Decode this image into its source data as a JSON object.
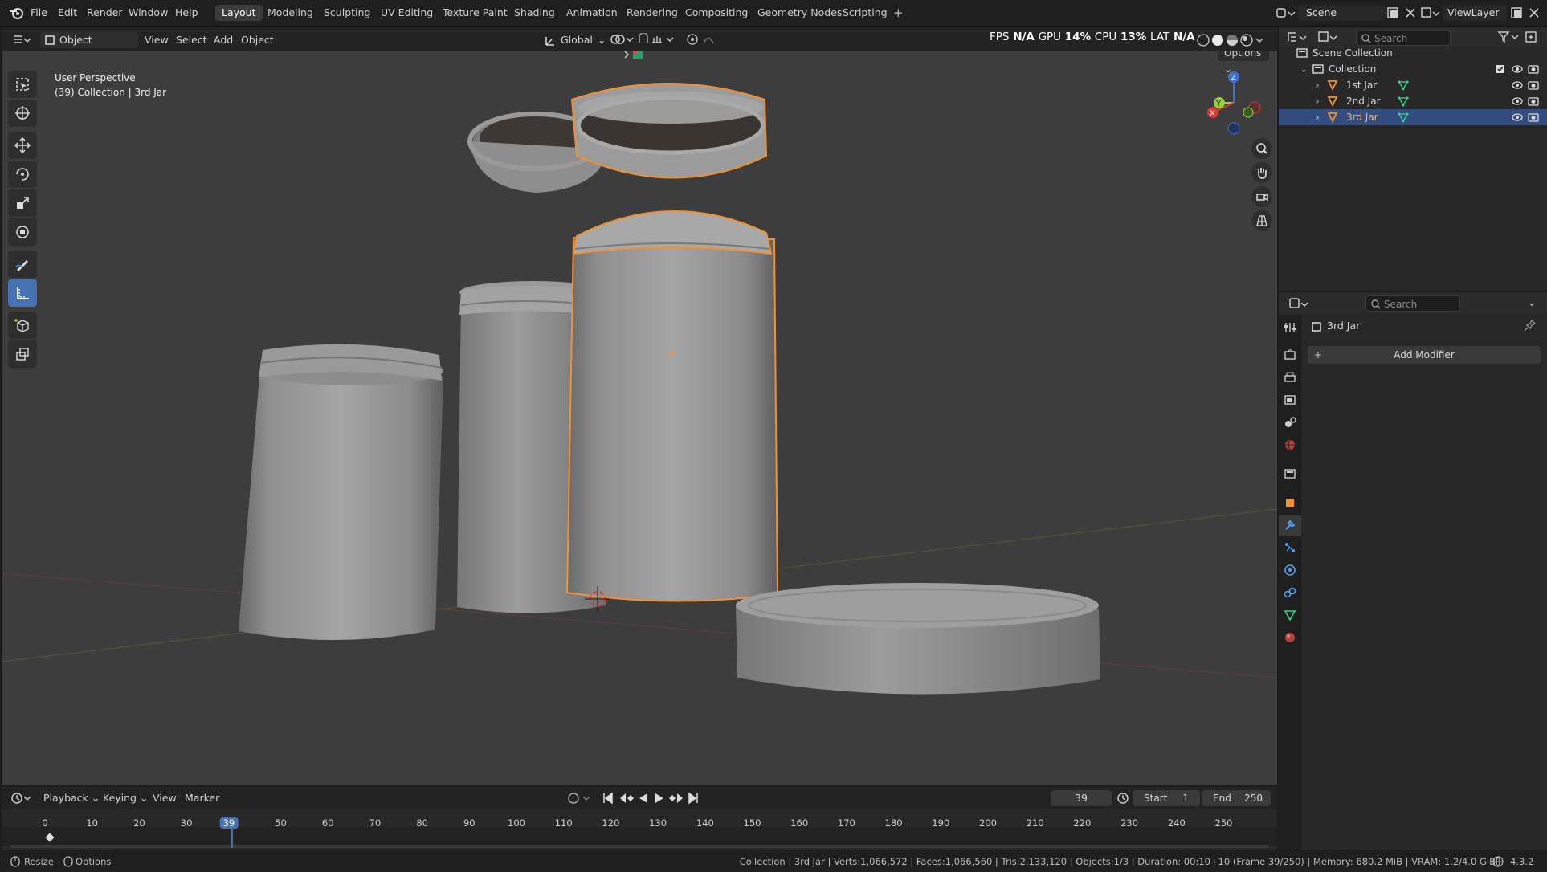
{
  "menu": {
    "file": "File",
    "edit": "Edit",
    "render": "Render",
    "window": "Window",
    "help": "Help"
  },
  "workspaces": [
    "Layout",
    "Modeling",
    "Sculpting",
    "UV Editing",
    "Texture Paint",
    "Shading",
    "Animation",
    "Rendering",
    "Compositing",
    "Geometry Nodes",
    "Scripting"
  ],
  "topright": {
    "scene": "Scene",
    "view_layer": "ViewLayer"
  },
  "viewport_header": {
    "mode": "Object Mode",
    "view": "View",
    "select": "Select",
    "add": "Add",
    "object": "Object",
    "orientation": "Global",
    "options": "Options",
    "perf_fps": "FPS",
    "perf_fps_val": "N/A",
    "perf_gpu": "GPU",
    "perf_gpu_val": "14%",
    "perf_cpu": "CPU",
    "perf_cpu_val": "13%",
    "perf_lat": "LAT",
    "perf_lat_val": "N/A"
  },
  "viewport_info": {
    "line1": "User Perspective",
    "line2": "(39) Collection | 3rd Jar"
  },
  "gizmo": {
    "z": "Z",
    "y": "Y",
    "x": "X"
  },
  "outliner": {
    "search_placeholder": "Search",
    "scene_collection": "Scene Collection",
    "collection": "Collection",
    "items": [
      "1st Jar",
      "2nd Jar",
      "3rd Jar"
    ]
  },
  "properties": {
    "search_placeholder": "Search",
    "object_name": "3rd Jar",
    "add_modifier": "Add Modifier"
  },
  "timeline": {
    "playback": "Playback",
    "keying": "Keying",
    "view": "View",
    "marker": "Marker",
    "current_frame": "39",
    "start_label": "Start",
    "start": "1",
    "end_label": "End",
    "end": "250",
    "ticks": [
      "0",
      "10",
      "20",
      "30",
      "39",
      "50",
      "60",
      "70",
      "80",
      "90",
      "100",
      "110",
      "120",
      "130",
      "140",
      "150",
      "160",
      "170",
      "180",
      "190",
      "200",
      "210",
      "220",
      "230",
      "240",
      "250"
    ]
  },
  "status": {
    "resize": "Resize",
    "options": "Options",
    "info": "Collection | 3rd Jar | Verts:1,066,572 | Faces:1,066,560 | Tris:2,133,120 | Objects:1/3 | Duration: 00:10+10 (Frame 39/250) | Memory: 680.2 MiB | VRAM: 1.2/4.0 GiB",
    "version": "4.3.2"
  },
  "colors": {
    "accent": "#4772b3",
    "selected": "#f2912f",
    "viewport_bg": "#3d3d3d",
    "panel": "#282828"
  }
}
